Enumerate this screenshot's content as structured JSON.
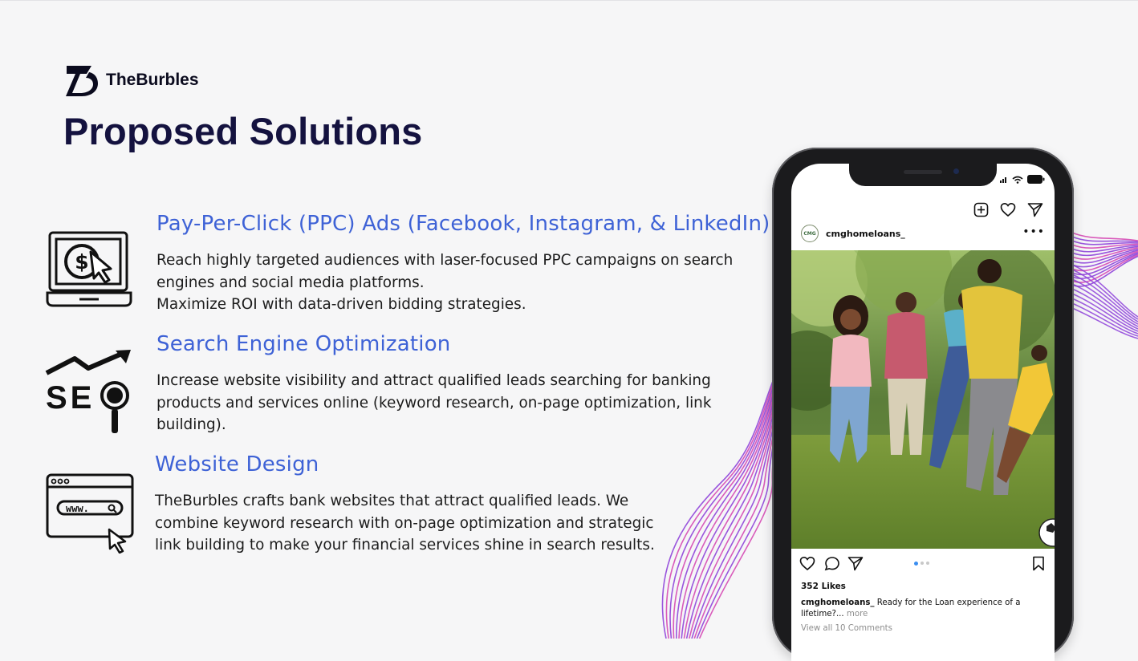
{
  "brand": {
    "name": "TheBurbles"
  },
  "page_title": "Proposed Solutions",
  "solutions": [
    {
      "heading": "Pay-Per-Click (PPC) Ads (Facebook, Instagram, & LinkedIn)",
      "lines": [
        "Reach highly targeted audiences with laser-focused PPC campaigns on search",
        "engines and social media platforms.",
        "Maximize ROI with data-driven bidding strategies."
      ],
      "icon": "laptop-dollar-cursor-icon"
    },
    {
      "heading": "Search Engine Optimization",
      "lines": [
        "Increase website visibility and attract qualified leads searching for banking",
        "products and services online (keyword research, on-page optimization, link",
        "building)."
      ],
      "icon": "seo-growth-icon",
      "icon_text": "SE"
    },
    {
      "heading": "Website Design",
      "lines": [
        "TheBurbles crafts bank websites that attract qualified leads. We",
        "combine keyword research with on-page optimization and strategic",
        "link building to make your financial services shine in search results."
      ],
      "icon": "browser-www-icon",
      "icon_text": "www."
    }
  ],
  "phone": {
    "post": {
      "username": "cmghomeloans_",
      "avatar_text": "CMG",
      "likes": "352 Likes",
      "caption_user": "cmghomeloans_",
      "caption_text": "Ready for the Loan experience of a lifetime?...",
      "caption_more": "more",
      "comments": "View all 10 Comments"
    }
  },
  "colors": {
    "heading": "#3e62d6",
    "title": "#14123f",
    "wave_pink": "#d43fb0",
    "wave_purple": "#8a3ad8"
  }
}
